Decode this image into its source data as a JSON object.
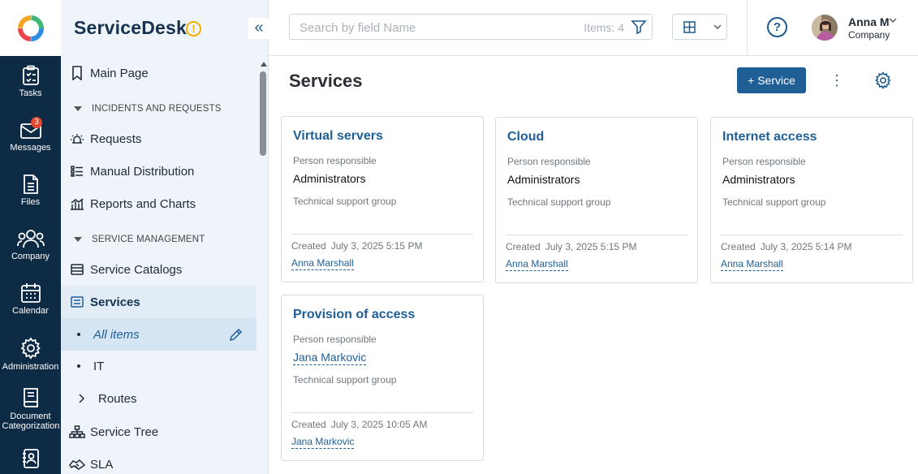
{
  "rail": {
    "items": [
      {
        "label": "Tasks",
        "icon": "clipboard-icon"
      },
      {
        "label": "Messages",
        "icon": "envelope-icon",
        "badge": "3"
      },
      {
        "label": "Files",
        "icon": "file-icon"
      },
      {
        "label": "Company",
        "icon": "users-icon"
      },
      {
        "label": "Calendar",
        "icon": "calendar-icon"
      },
      {
        "label": "Administration",
        "icon": "gear-icon"
      },
      {
        "label": "Document Categorization",
        "icon": "book-icon"
      },
      {
        "label": "",
        "icon": "contacts-icon"
      }
    ]
  },
  "nav": {
    "brand": "ServiceDesk",
    "warn": "!",
    "collapse": "«",
    "main_page": "Main Page",
    "section_incidents": "INCIDENTS AND REQUESTS",
    "requests": "Requests",
    "manual_distribution": "Manual Distribution",
    "reports": "Reports and Charts",
    "section_service": "SERVICE MANAGEMENT",
    "service_catalogs": "Service Catalogs",
    "services": "Services",
    "all_items": "All items",
    "it": "IT",
    "routes": "Routes",
    "service_tree": "Service Tree",
    "sla": "SLA"
  },
  "topbar": {
    "search_placeholder": "Search by field Name",
    "items_count": "Items: 4",
    "help": "?",
    "user_name": "Anna M",
    "user_company": "Company"
  },
  "main": {
    "title": "Services",
    "add_button": "+ Service",
    "more": "⋮"
  },
  "labels": {
    "person_responsible": "Person responsible",
    "tech_group": "Technical support group",
    "created": "Created"
  },
  "cards": [
    {
      "title": "Virtual servers",
      "person": "Administrators",
      "created": "July 3, 2025 5:15 PM",
      "author": "Anna Marshall"
    },
    {
      "title": "Cloud",
      "person": "Administrators",
      "created": "July 3, 2025 5:15 PM",
      "author": "Anna Marshall"
    },
    {
      "title": "Internet access",
      "person": "Administrators",
      "created": "July 3, 2025 5:14 PM",
      "author": "Anna Marshall"
    },
    {
      "title": "Provision of access",
      "person": "Jana Markovic",
      "created": "July 3, 2025 10:05 AM",
      "author": "Jana Markovic"
    }
  ],
  "colors": {
    "rail": "#0e2b45",
    "accent": "#1f5f96",
    "nav_bg": "#eef4fa",
    "badge": "#e2462f"
  }
}
